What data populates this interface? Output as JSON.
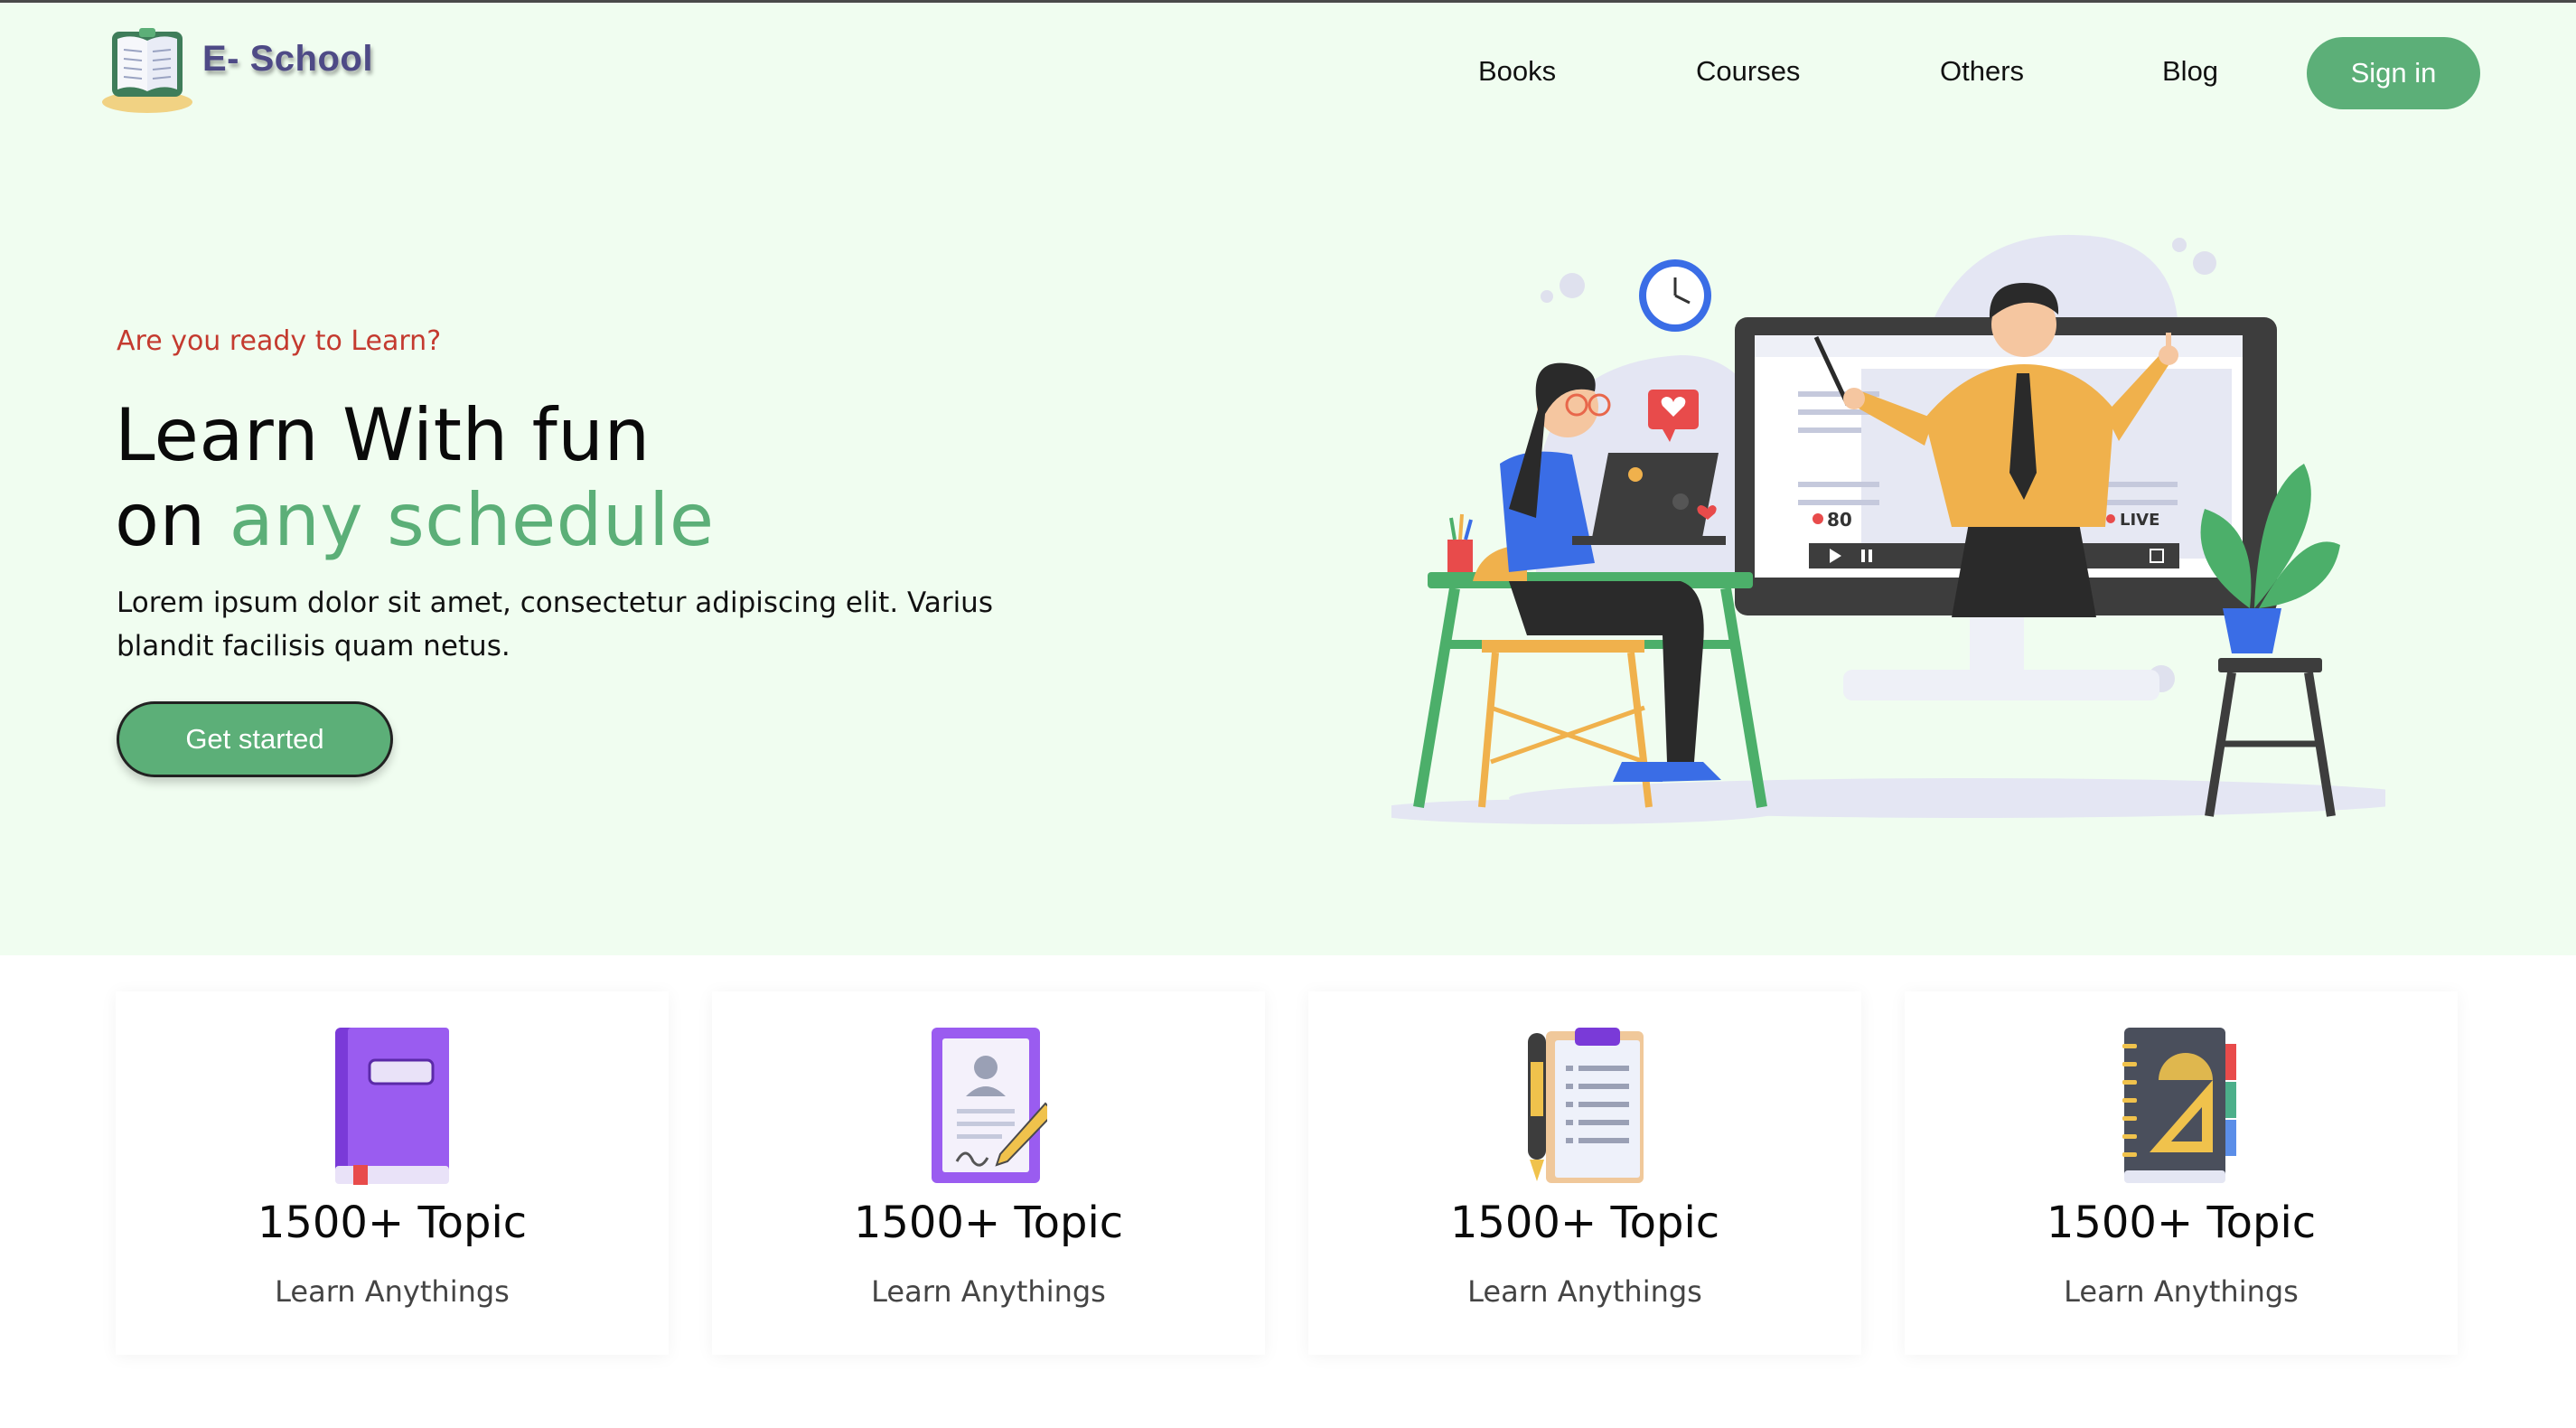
{
  "header": {
    "logo_text": "E- School",
    "nav": [
      "Books",
      "Courses",
      "Others",
      "Blog"
    ],
    "signin_label": "Sign in"
  },
  "hero": {
    "kicker": "Are you ready to Learn?",
    "title_line1": "Learn With fun",
    "title_line2_prefix": "on ",
    "title_line2_accent": "any schedule",
    "description": "Lorem ipsum dolor sit amet, consectetur adipiscing elit. Varius blandit facilisis quam netus.",
    "cta_label": "Get started",
    "illustration": {
      "viewer_count": "80",
      "live_label": "LIVE"
    }
  },
  "cards": [
    {
      "icon": "book-icon",
      "title": "1500+ Topic",
      "subtitle": "Learn Anythings"
    },
    {
      "icon": "certificate-icon",
      "title": "1500+ Topic",
      "subtitle": "Learn Anythings"
    },
    {
      "icon": "clipboard-icon",
      "title": "1500+ Topic",
      "subtitle": "Learn Anythings"
    },
    {
      "icon": "notebook-icon",
      "title": "1500+ Topic",
      "subtitle": "Learn Anythings"
    }
  ],
  "colors": {
    "accent": "#5caf78",
    "hero_bg": "#f0fdf0",
    "kicker": "#c43a2f",
    "logo_text": "#4e4a86"
  }
}
